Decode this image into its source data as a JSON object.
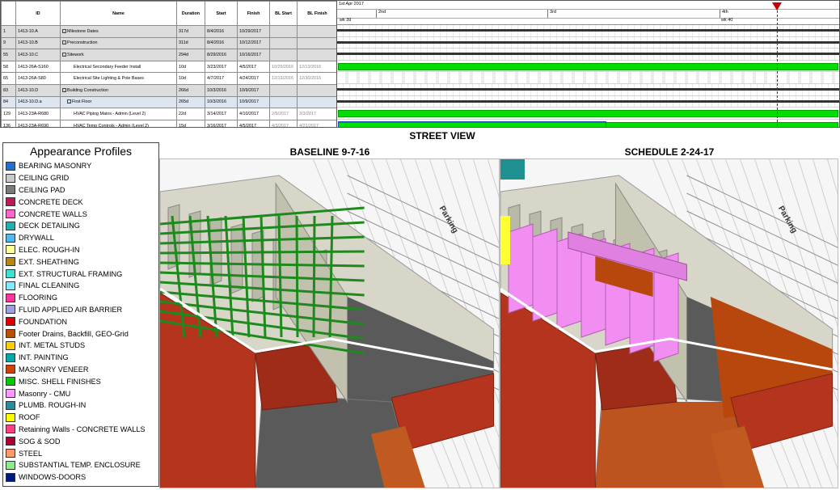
{
  "schedule": {
    "headers": [
      "ID",
      "Name",
      "Duration",
      "Start",
      "Finish",
      "BL Start",
      "BL Finish"
    ],
    "rows": [
      {
        "num": "1",
        "id": "1413-10.A",
        "name": "Milestone Dates",
        "indent": 0,
        "toggle": "-",
        "duration": "317d",
        "start": "8/4/2016",
        "finish": "10/29/2017",
        "bl_start": "",
        "bl_finish": "",
        "kind": "summary"
      },
      {
        "num": "9",
        "id": "1413-10.B",
        "name": "Preconstruction",
        "indent": 0,
        "toggle": "-",
        "duration": "311d",
        "start": "8/4/2016",
        "finish": "10/12/2017",
        "bl_start": "",
        "bl_finish": "",
        "kind": "summary"
      },
      {
        "num": "55",
        "id": "1413-10.C",
        "name": "Sitework",
        "indent": 0,
        "toggle": "-",
        "duration": "294d",
        "start": "8/29/2016",
        "finish": "10/16/2017",
        "bl_start": "",
        "bl_finish": "",
        "kind": "summary"
      },
      {
        "num": "58",
        "id": "1413-26A-S160",
        "name": "Electrical Secondary Feeder Install",
        "indent": 2,
        "toggle": "",
        "duration": "10d",
        "start": "3/23/2017",
        "finish": "4/5/2017",
        "bl_start": "10/25/2016",
        "bl_finish": "12/13/2016",
        "kind": "task"
      },
      {
        "num": "65",
        "id": "1413-26A-S80",
        "name": "Electrical Site Lighting & Pole Bases",
        "indent": 2,
        "toggle": "",
        "duration": "10d",
        "start": "4/7/2017",
        "finish": "4/24/2017",
        "bl_start": "12/19/2016",
        "bl_finish": "12/30/2016",
        "kind": "task"
      },
      {
        "num": "83",
        "id": "1413-10.D",
        "name": "Building Construction",
        "indent": 0,
        "toggle": "-",
        "duration": "266d",
        "start": "10/3/2016",
        "finish": "10/9/2017",
        "bl_start": "",
        "bl_finish": "",
        "kind": "summary"
      },
      {
        "num": "84",
        "id": "1413-10.D.a",
        "name": "First Floor",
        "indent": 1,
        "toggle": "-",
        "duration": "265d",
        "start": "10/3/2016",
        "finish": "10/9/2017",
        "bl_start": "",
        "bl_finish": "",
        "kind": "selected"
      },
      {
        "num": "129",
        "id": "1413-23A-R680",
        "name": "HVAC Piping Mains - Admin (Level 2)",
        "indent": 2,
        "toggle": "",
        "duration": "22d",
        "start": "3/14/2017",
        "finish": "4/10/2017",
        "bl_start": "2/9/2017",
        "bl_finish": "3/3/2017",
        "kind": "task"
      },
      {
        "num": "136",
        "id": "1413-23A-R690",
        "name": "HVAC Temp Controls - Admin (Level 2)",
        "indent": 2,
        "toggle": "",
        "duration": "15d",
        "start": "3/16/2017",
        "finish": "4/5/2017",
        "bl_start": "4/3/2017",
        "bl_finish": "4/21/2017",
        "kind": "task"
      }
    ]
  },
  "gantt": {
    "month": "1st Apr 2017",
    "weeks": [
      "2nd",
      "3rd",
      "4th"
    ],
    "week_numbers": [
      "wk 39",
      "wk 40"
    ],
    "bars": [
      "summary",
      "summary",
      "summary",
      "green",
      "light",
      "summary",
      "summary",
      "green",
      "green-blue"
    ],
    "today_color": "#c80000"
  },
  "titles": {
    "street_view": "STREET VIEW",
    "baseline": "BASELINE 9-7-16",
    "schedule": "SCHEDULE 2-24-17"
  },
  "legend": {
    "title": "Appearance Profiles",
    "items": [
      {
        "label": "BEARING MASONRY",
        "color": "#1f6fd8"
      },
      {
        "label": "CEILING GRID",
        "color": "#c8c8c8"
      },
      {
        "label": "CEILING PAD",
        "color": "#7a7a7a"
      },
      {
        "label": "CONCRETE DECK",
        "color": "#c0185a"
      },
      {
        "label": "CONCRETE WALLS",
        "color": "#ff66cc"
      },
      {
        "label": "DECK DETAILING",
        "color": "#20b0b0"
      },
      {
        "label": "DRYWALL",
        "color": "#4fb8f0"
      },
      {
        "label": "ELEC. ROUGH-IN",
        "color": "#ffff99"
      },
      {
        "label": "EXT. SHEATHING",
        "color": "#b8860b"
      },
      {
        "label": "EXT. STRUCTURAL FRAMING",
        "color": "#40e0d0"
      },
      {
        "label": "FINAL CLEANING",
        "color": "#80e8ff"
      },
      {
        "label": "FLOORING",
        "color": "#ff3399"
      },
      {
        "label": "FLUID APPLIED AIR BARRIER",
        "color": "#a0a0e0"
      },
      {
        "label": "FOUNDATION",
        "color": "#e00000"
      },
      {
        "label": "Footer Drains, Backfill, GEO-Grid",
        "color": "#b85000"
      },
      {
        "label": "INT. METAL STUDS",
        "color": "#ffcc00"
      },
      {
        "label": "INT. PAINTING",
        "color": "#00aaaa"
      },
      {
        "label": "MASONRY VENEER",
        "color": "#cc4400"
      },
      {
        "label": "MISC. SHELL FINISHES",
        "color": "#00cc00"
      },
      {
        "label": "Masonry - CMU",
        "color": "#ff99ff"
      },
      {
        "label": "PLUMB. ROUGH-IN",
        "color": "#2090a0"
      },
      {
        "label": "ROOF",
        "color": "#ffff00"
      },
      {
        "label": "Retaining Walls - CONCRETE WALLS",
        "color": "#ff4080"
      },
      {
        "label": "SOG & SOD",
        "color": "#aa0033"
      },
      {
        "label": "STEEL",
        "color": "#ff9966"
      },
      {
        "label": "SUBSTANTIAL TEMP. ENCLOSURE",
        "color": "#88ee88"
      },
      {
        "label": "WINDOWS-DOORS",
        "color": "#001a80"
      }
    ]
  },
  "views": {
    "parking_label": "Parking",
    "colors": {
      "brick": "#b5341d",
      "wall": "#b9b9a8",
      "gravel": "#5a5a5a",
      "pipe": "#1e8a1e",
      "pink": "#f28ef2",
      "floor": "#b8470d",
      "cyan": "#2aaad0"
    }
  }
}
